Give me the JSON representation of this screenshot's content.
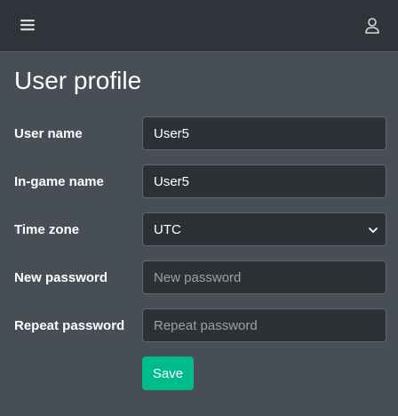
{
  "navbar": {
    "menu_icon": "hamburger-menu-icon",
    "user_icon": "user-icon"
  },
  "page": {
    "title": "User profile"
  },
  "form": {
    "username": {
      "label": "User name",
      "value": "User5"
    },
    "ingame_name": {
      "label": "In-game name",
      "value": "User5"
    },
    "timezone": {
      "label": "Time zone",
      "value": "UTC"
    },
    "new_password": {
      "label": "New password",
      "placeholder": "New password",
      "value": ""
    },
    "repeat_password": {
      "label": "Repeat password",
      "placeholder": "Repeat password",
      "value": ""
    },
    "save_label": "Save"
  },
  "colors": {
    "background": "#474e55",
    "navbar": "#30343a",
    "input_bg": "#2d3136",
    "accent": "#00bc8c"
  }
}
